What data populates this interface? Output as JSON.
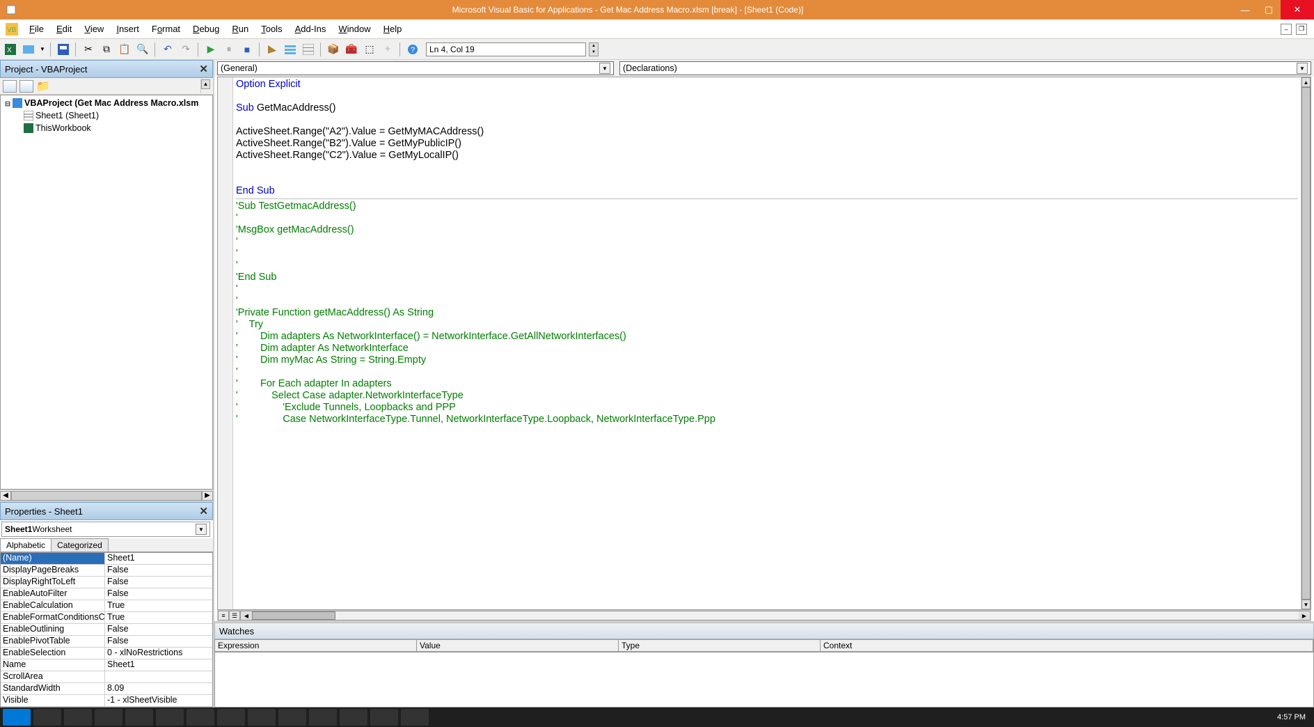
{
  "titlebar": {
    "text": "Microsoft Visual Basic for Applications - Get Mac Address Macro.xlsm [break] - [Sheet1 (Code)]"
  },
  "menu": {
    "file": "File",
    "edit": "Edit",
    "view": "View",
    "insert": "Insert",
    "format": "Format",
    "debug": "Debug",
    "run": "Run",
    "tools": "Tools",
    "addins": "Add-Ins",
    "window": "Window",
    "help": "Help"
  },
  "toolbar": {
    "cursor_pos": "Ln 4, Col 19"
  },
  "project_panel": {
    "title": "Project - VBAProject",
    "root": "VBAProject (Get Mac Address Macro.xlsm",
    "items": [
      "Sheet1 (Sheet1)",
      "ThisWorkbook"
    ]
  },
  "properties_panel": {
    "title": "Properties - Sheet1",
    "object_bold": "Sheet1",
    "object_type": " Worksheet",
    "tabs": {
      "alpha": "Alphabetic",
      "cat": "Categorized"
    },
    "rows": [
      {
        "name": "(Name)",
        "value": "Sheet1",
        "sel": true
      },
      {
        "name": "DisplayPageBreaks",
        "value": "False"
      },
      {
        "name": "DisplayRightToLeft",
        "value": "False"
      },
      {
        "name": "EnableAutoFilter",
        "value": "False"
      },
      {
        "name": "EnableCalculation",
        "value": "True"
      },
      {
        "name": "EnableFormatConditionsCa",
        "value": "True"
      },
      {
        "name": "EnableOutlining",
        "value": "False"
      },
      {
        "name": "EnablePivotTable",
        "value": "False"
      },
      {
        "name": "EnableSelection",
        "value": "0 - xlNoRestrictions"
      },
      {
        "name": "Name",
        "value": "Sheet1"
      },
      {
        "name": "ScrollArea",
        "value": ""
      },
      {
        "name": "StandardWidth",
        "value": "8.09"
      },
      {
        "name": "Visible",
        "value": "-1 - xlSheetVisible"
      }
    ]
  },
  "code": {
    "object_dd": "(General)",
    "proc_dd": "(Declarations)",
    "lines": [
      {
        "t": "kw",
        "s": "Option Explicit"
      },
      {
        "t": "",
        "s": ""
      },
      {
        "t": "mix",
        "parts": [
          {
            "c": "kw",
            "s": "Sub"
          },
          {
            "c": "",
            "s": " GetMacAddress()"
          }
        ]
      },
      {
        "t": "",
        "s": ""
      },
      {
        "t": "",
        "s": "ActiveSheet.Range(\"A2\").Value = GetMyMACAddress()"
      },
      {
        "t": "",
        "s": "ActiveSheet.Range(\"B2\").Value = GetMyPublicIP()"
      },
      {
        "t": "",
        "s": "ActiveSheet.Range(\"C2\").Value = GetMyLocalIP()"
      },
      {
        "t": "",
        "s": ""
      },
      {
        "t": "",
        "s": ""
      },
      {
        "t": "kw",
        "s": "End Sub"
      },
      {
        "t": "hr",
        "s": ""
      },
      {
        "t": "cm",
        "s": "'Sub TestGetmacAddress()"
      },
      {
        "t": "cm",
        "s": "'"
      },
      {
        "t": "cm",
        "s": "'MsgBox getMacAddress()"
      },
      {
        "t": "cm",
        "s": "'"
      },
      {
        "t": "cm",
        "s": "'"
      },
      {
        "t": "cm",
        "s": "'"
      },
      {
        "t": "cm",
        "s": "'End Sub"
      },
      {
        "t": "cm",
        "s": "'"
      },
      {
        "t": "cm",
        "s": "'"
      },
      {
        "t": "cm",
        "s": "'Private Function getMacAddress() As String"
      },
      {
        "t": "cm",
        "s": "'    Try"
      },
      {
        "t": "cm",
        "s": "'        Dim adapters As NetworkInterface() = NetworkInterface.GetAllNetworkInterfaces()"
      },
      {
        "t": "cm",
        "s": "'        Dim adapter As NetworkInterface"
      },
      {
        "t": "cm",
        "s": "'        Dim myMac As String = String.Empty"
      },
      {
        "t": "cm",
        "s": "'"
      },
      {
        "t": "cm",
        "s": "'        For Each adapter In adapters"
      },
      {
        "t": "cm",
        "s": "'            Select Case adapter.NetworkInterfaceType"
      },
      {
        "t": "cm",
        "s": "'                'Exclude Tunnels, Loopbacks and PPP"
      },
      {
        "t": "cm",
        "s": "'                Case NetworkInterfaceType.Tunnel, NetworkInterfaceType.Loopback, NetworkInterfaceType.Ppp"
      }
    ]
  },
  "watches": {
    "title": "Watches",
    "cols": {
      "exp": "Expression",
      "val": "Value",
      "typ": "Type",
      "ctx": "Context"
    }
  },
  "taskbar": {
    "clock": "4:57 PM"
  }
}
